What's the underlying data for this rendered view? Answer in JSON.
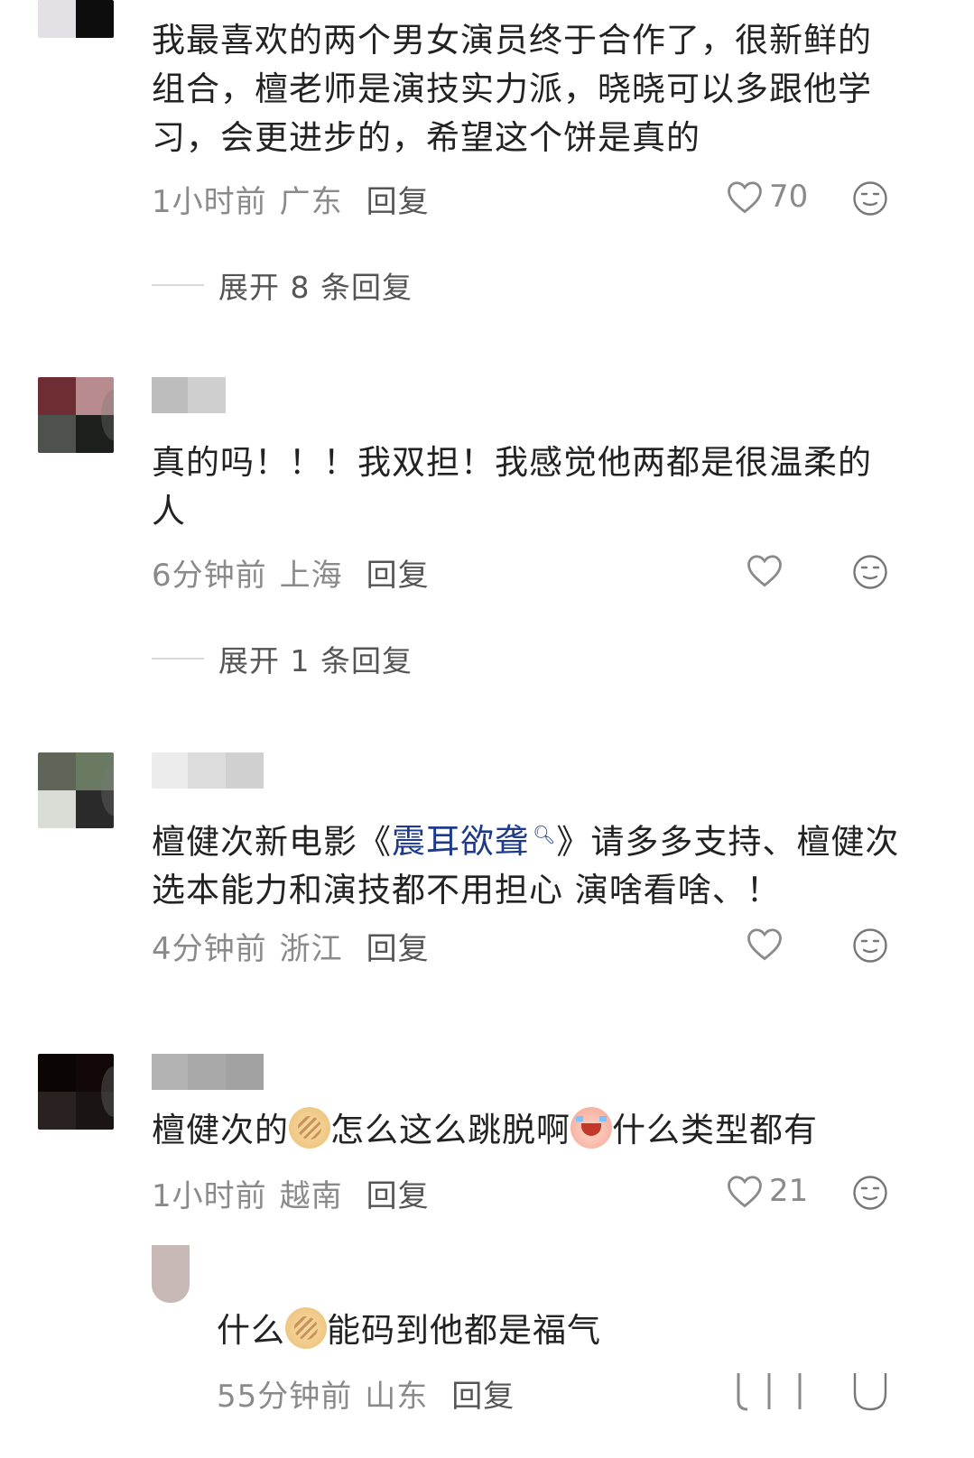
{
  "comments": [
    {
      "text": "我最喜欢的两个男女演员终于合作了，很新鲜的组合，檀老师是演技实力派，晓晓可以多跟他学习，会更进步的，希望这个饼是真的",
      "time": "1小时前",
      "location": "广东",
      "reply_label": "回复",
      "likes": "70",
      "expand_label": "展开 8 条回复"
    },
    {
      "text": "真的吗！！！我双担！我感觉他两都是很温柔的人",
      "time": "6分钟前",
      "location": "上海",
      "reply_label": "回复",
      "likes": "",
      "expand_label": "展开 1 条回复"
    },
    {
      "text_before": "檀健次新电影《",
      "link_text": "震耳欲聋",
      "text_after": "》请多多支持、檀健次选本能力和演技都不用担心 演啥看啥、！",
      "time": "4分钟前",
      "location": "浙江",
      "reply_label": "回复",
      "likes": ""
    },
    {
      "text_1": "檀健次的",
      "text_2": "怎么这么跳脱啊",
      "text_3": "什么类型都有",
      "time": "1小时前",
      "location": "越南",
      "reply_label": "回复",
      "likes": "21"
    },
    {
      "text_1": "什么",
      "text_2": "能码到他都是福气",
      "time": "55分钟前",
      "location": "山东",
      "reply_label": "回复"
    }
  ],
  "icons": {
    "like": "heart-outline-icon",
    "emoji": "neutral-face-icon",
    "search": "search-icon",
    "bread_emoji": "flatbread-emoji",
    "crying_emoji": "crying-face-emoji"
  },
  "colors": {
    "text": "#222222",
    "meta": "#8a8a8a",
    "link": "#1e3a8a"
  }
}
